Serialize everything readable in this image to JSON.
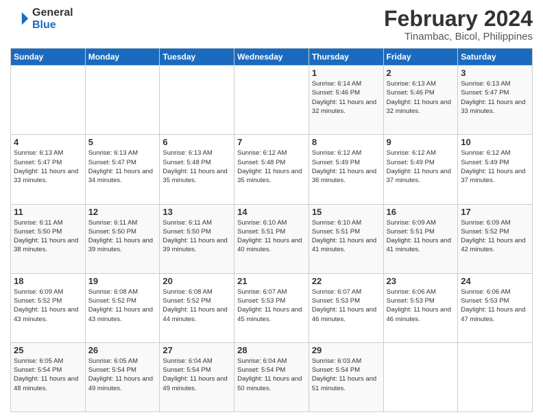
{
  "logo": {
    "text_general": "General",
    "text_blue": "Blue"
  },
  "header": {
    "month": "February 2024",
    "location": "Tinambac, Bicol, Philippines"
  },
  "weekdays": [
    "Sunday",
    "Monday",
    "Tuesday",
    "Wednesday",
    "Thursday",
    "Friday",
    "Saturday"
  ],
  "weeks": [
    [
      {
        "day": "",
        "sunrise": "",
        "sunset": "",
        "daylight": ""
      },
      {
        "day": "",
        "sunrise": "",
        "sunset": "",
        "daylight": ""
      },
      {
        "day": "",
        "sunrise": "",
        "sunset": "",
        "daylight": ""
      },
      {
        "day": "",
        "sunrise": "",
        "sunset": "",
        "daylight": ""
      },
      {
        "day": "1",
        "sunrise": "Sunrise: 6:14 AM",
        "sunset": "Sunset: 5:46 PM",
        "daylight": "Daylight: 11 hours and 32 minutes."
      },
      {
        "day": "2",
        "sunrise": "Sunrise: 6:13 AM",
        "sunset": "Sunset: 5:46 PM",
        "daylight": "Daylight: 11 hours and 32 minutes."
      },
      {
        "day": "3",
        "sunrise": "Sunrise: 6:13 AM",
        "sunset": "Sunset: 5:47 PM",
        "daylight": "Daylight: 11 hours and 33 minutes."
      }
    ],
    [
      {
        "day": "4",
        "sunrise": "Sunrise: 6:13 AM",
        "sunset": "Sunset: 5:47 PM",
        "daylight": "Daylight: 11 hours and 33 minutes."
      },
      {
        "day": "5",
        "sunrise": "Sunrise: 6:13 AM",
        "sunset": "Sunset: 5:47 PM",
        "daylight": "Daylight: 11 hours and 34 minutes."
      },
      {
        "day": "6",
        "sunrise": "Sunrise: 6:13 AM",
        "sunset": "Sunset: 5:48 PM",
        "daylight": "Daylight: 11 hours and 35 minutes."
      },
      {
        "day": "7",
        "sunrise": "Sunrise: 6:12 AM",
        "sunset": "Sunset: 5:48 PM",
        "daylight": "Daylight: 11 hours and 35 minutes."
      },
      {
        "day": "8",
        "sunrise": "Sunrise: 6:12 AM",
        "sunset": "Sunset: 5:49 PM",
        "daylight": "Daylight: 11 hours and 36 minutes."
      },
      {
        "day": "9",
        "sunrise": "Sunrise: 6:12 AM",
        "sunset": "Sunset: 5:49 PM",
        "daylight": "Daylight: 11 hours and 37 minutes."
      },
      {
        "day": "10",
        "sunrise": "Sunrise: 6:12 AM",
        "sunset": "Sunset: 5:49 PM",
        "daylight": "Daylight: 11 hours and 37 minutes."
      }
    ],
    [
      {
        "day": "11",
        "sunrise": "Sunrise: 6:11 AM",
        "sunset": "Sunset: 5:50 PM",
        "daylight": "Daylight: 11 hours and 38 minutes."
      },
      {
        "day": "12",
        "sunrise": "Sunrise: 6:11 AM",
        "sunset": "Sunset: 5:50 PM",
        "daylight": "Daylight: 11 hours and 39 minutes."
      },
      {
        "day": "13",
        "sunrise": "Sunrise: 6:11 AM",
        "sunset": "Sunset: 5:50 PM",
        "daylight": "Daylight: 11 hours and 39 minutes."
      },
      {
        "day": "14",
        "sunrise": "Sunrise: 6:10 AM",
        "sunset": "Sunset: 5:51 PM",
        "daylight": "Daylight: 11 hours and 40 minutes."
      },
      {
        "day": "15",
        "sunrise": "Sunrise: 6:10 AM",
        "sunset": "Sunset: 5:51 PM",
        "daylight": "Daylight: 11 hours and 41 minutes."
      },
      {
        "day": "16",
        "sunrise": "Sunrise: 6:09 AM",
        "sunset": "Sunset: 5:51 PM",
        "daylight": "Daylight: 11 hours and 41 minutes."
      },
      {
        "day": "17",
        "sunrise": "Sunrise: 6:09 AM",
        "sunset": "Sunset: 5:52 PM",
        "daylight": "Daylight: 11 hours and 42 minutes."
      }
    ],
    [
      {
        "day": "18",
        "sunrise": "Sunrise: 6:09 AM",
        "sunset": "Sunset: 5:52 PM",
        "daylight": "Daylight: 11 hours and 43 minutes."
      },
      {
        "day": "19",
        "sunrise": "Sunrise: 6:08 AM",
        "sunset": "Sunset: 5:52 PM",
        "daylight": "Daylight: 11 hours and 43 minutes."
      },
      {
        "day": "20",
        "sunrise": "Sunrise: 6:08 AM",
        "sunset": "Sunset: 5:52 PM",
        "daylight": "Daylight: 11 hours and 44 minutes."
      },
      {
        "day": "21",
        "sunrise": "Sunrise: 6:07 AM",
        "sunset": "Sunset: 5:53 PM",
        "daylight": "Daylight: 11 hours and 45 minutes."
      },
      {
        "day": "22",
        "sunrise": "Sunrise: 6:07 AM",
        "sunset": "Sunset: 5:53 PM",
        "daylight": "Daylight: 11 hours and 46 minutes."
      },
      {
        "day": "23",
        "sunrise": "Sunrise: 6:06 AM",
        "sunset": "Sunset: 5:53 PM",
        "daylight": "Daylight: 11 hours and 46 minutes."
      },
      {
        "day": "24",
        "sunrise": "Sunrise: 6:06 AM",
        "sunset": "Sunset: 5:53 PM",
        "daylight": "Daylight: 11 hours and 47 minutes."
      }
    ],
    [
      {
        "day": "25",
        "sunrise": "Sunrise: 6:05 AM",
        "sunset": "Sunset: 5:54 PM",
        "daylight": "Daylight: 11 hours and 48 minutes."
      },
      {
        "day": "26",
        "sunrise": "Sunrise: 6:05 AM",
        "sunset": "Sunset: 5:54 PM",
        "daylight": "Daylight: 11 hours and 49 minutes."
      },
      {
        "day": "27",
        "sunrise": "Sunrise: 6:04 AM",
        "sunset": "Sunset: 5:54 PM",
        "daylight": "Daylight: 11 hours and 49 minutes."
      },
      {
        "day": "28",
        "sunrise": "Sunrise: 6:04 AM",
        "sunset": "Sunset: 5:54 PM",
        "daylight": "Daylight: 11 hours and 50 minutes."
      },
      {
        "day": "29",
        "sunrise": "Sunrise: 6:03 AM",
        "sunset": "Sunset: 5:54 PM",
        "daylight": "Daylight: 11 hours and 51 minutes."
      },
      {
        "day": "",
        "sunrise": "",
        "sunset": "",
        "daylight": ""
      },
      {
        "day": "",
        "sunrise": "",
        "sunset": "",
        "daylight": ""
      }
    ]
  ]
}
